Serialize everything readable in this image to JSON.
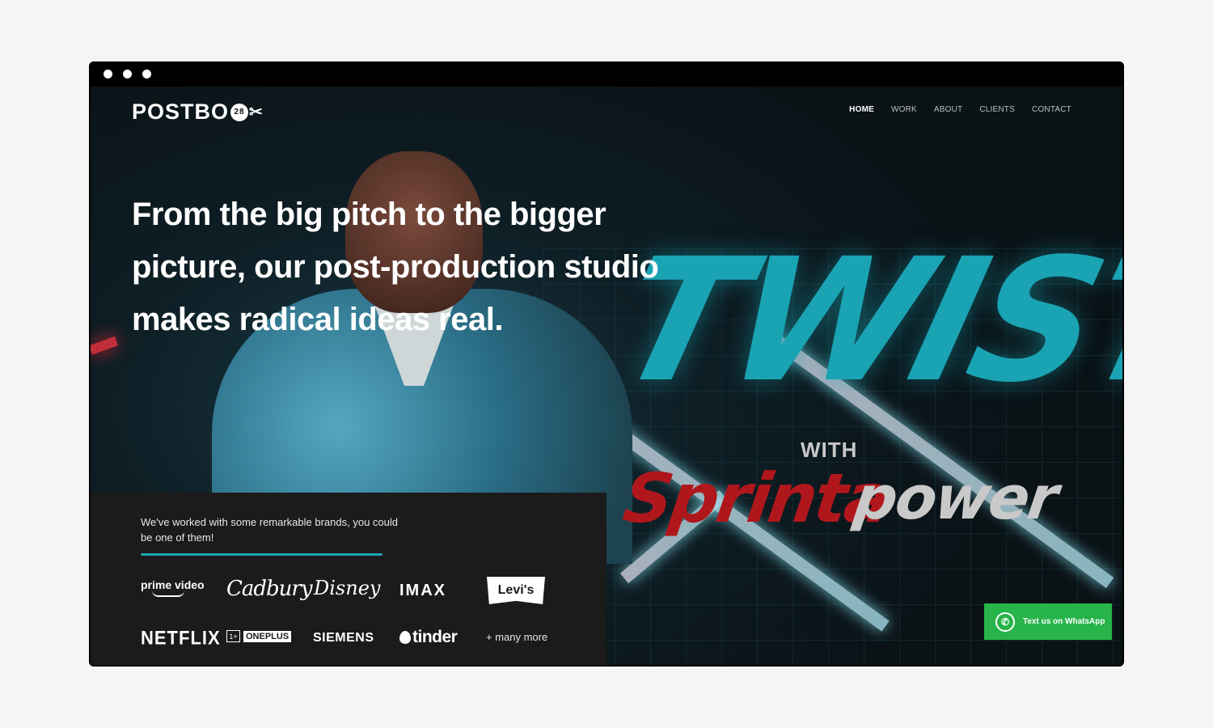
{
  "window": {
    "dots": [
      "",
      "",
      ""
    ]
  },
  "header": {
    "logo_text": "POSTBO",
    "logo_badge": "28",
    "logo_icon": "scissors-icon",
    "nav": [
      {
        "label": "HOME",
        "active": true
      },
      {
        "label": "WORK",
        "active": false
      },
      {
        "label": "ABOUT",
        "active": false
      },
      {
        "label": "CLIENTS",
        "active": false
      },
      {
        "label": "CONTACT",
        "active": false
      }
    ]
  },
  "hero": {
    "headline_lines": [
      "From the big pitch to the bigger",
      "picture, our post-production studio",
      "makes radical ideas real."
    ],
    "background_text": {
      "twist": "TWIST",
      "with": "WITH",
      "sprinta": "Sprinta",
      "power": "power"
    }
  },
  "brands": {
    "intro": "We've worked with some remarkable brands, you could be one of them!",
    "accent_color": "#1aa6b5",
    "logos": {
      "prime_video": "prime video",
      "cadbury": "Cadbury",
      "disney": "Disney",
      "imax": "IMAX",
      "levis": "Levi's",
      "netflix": "NETFLIX",
      "oneplus": "ONEPLUS",
      "oneplus_mark": "1+",
      "siemens": "SIEMENS",
      "tinder": "tinder"
    },
    "more": "+ many more"
  },
  "whatsapp": {
    "label": "Text us on WhatsApp",
    "icon": "whatsapp-icon",
    "color": "#27b44b"
  }
}
